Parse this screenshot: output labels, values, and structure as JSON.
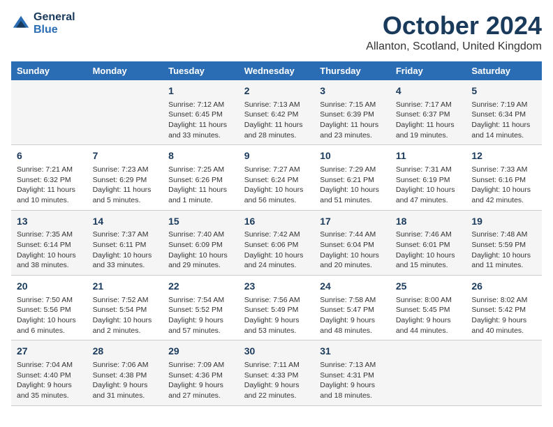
{
  "logo": {
    "line1": "General",
    "line2": "Blue"
  },
  "title": "October 2024",
  "subtitle": "Allanton, Scotland, United Kingdom",
  "days_of_week": [
    "Sunday",
    "Monday",
    "Tuesday",
    "Wednesday",
    "Thursday",
    "Friday",
    "Saturday"
  ],
  "weeks": [
    [
      {
        "num": "",
        "info": ""
      },
      {
        "num": "",
        "info": ""
      },
      {
        "num": "1",
        "info": "Sunrise: 7:12 AM\nSunset: 6:45 PM\nDaylight: 11 hours\nand 33 minutes."
      },
      {
        "num": "2",
        "info": "Sunrise: 7:13 AM\nSunset: 6:42 PM\nDaylight: 11 hours\nand 28 minutes."
      },
      {
        "num": "3",
        "info": "Sunrise: 7:15 AM\nSunset: 6:39 PM\nDaylight: 11 hours\nand 23 minutes."
      },
      {
        "num": "4",
        "info": "Sunrise: 7:17 AM\nSunset: 6:37 PM\nDaylight: 11 hours\nand 19 minutes."
      },
      {
        "num": "5",
        "info": "Sunrise: 7:19 AM\nSunset: 6:34 PM\nDaylight: 11 hours\nand 14 minutes."
      }
    ],
    [
      {
        "num": "6",
        "info": "Sunrise: 7:21 AM\nSunset: 6:32 PM\nDaylight: 11 hours\nand 10 minutes."
      },
      {
        "num": "7",
        "info": "Sunrise: 7:23 AM\nSunset: 6:29 PM\nDaylight: 11 hours\nand 5 minutes."
      },
      {
        "num": "8",
        "info": "Sunrise: 7:25 AM\nSunset: 6:26 PM\nDaylight: 11 hours\nand 1 minute."
      },
      {
        "num": "9",
        "info": "Sunrise: 7:27 AM\nSunset: 6:24 PM\nDaylight: 10 hours\nand 56 minutes."
      },
      {
        "num": "10",
        "info": "Sunrise: 7:29 AM\nSunset: 6:21 PM\nDaylight: 10 hours\nand 51 minutes."
      },
      {
        "num": "11",
        "info": "Sunrise: 7:31 AM\nSunset: 6:19 PM\nDaylight: 10 hours\nand 47 minutes."
      },
      {
        "num": "12",
        "info": "Sunrise: 7:33 AM\nSunset: 6:16 PM\nDaylight: 10 hours\nand 42 minutes."
      }
    ],
    [
      {
        "num": "13",
        "info": "Sunrise: 7:35 AM\nSunset: 6:14 PM\nDaylight: 10 hours\nand 38 minutes."
      },
      {
        "num": "14",
        "info": "Sunrise: 7:37 AM\nSunset: 6:11 PM\nDaylight: 10 hours\nand 33 minutes."
      },
      {
        "num": "15",
        "info": "Sunrise: 7:40 AM\nSunset: 6:09 PM\nDaylight: 10 hours\nand 29 minutes."
      },
      {
        "num": "16",
        "info": "Sunrise: 7:42 AM\nSunset: 6:06 PM\nDaylight: 10 hours\nand 24 minutes."
      },
      {
        "num": "17",
        "info": "Sunrise: 7:44 AM\nSunset: 6:04 PM\nDaylight: 10 hours\nand 20 minutes."
      },
      {
        "num": "18",
        "info": "Sunrise: 7:46 AM\nSunset: 6:01 PM\nDaylight: 10 hours\nand 15 minutes."
      },
      {
        "num": "19",
        "info": "Sunrise: 7:48 AM\nSunset: 5:59 PM\nDaylight: 10 hours\nand 11 minutes."
      }
    ],
    [
      {
        "num": "20",
        "info": "Sunrise: 7:50 AM\nSunset: 5:56 PM\nDaylight: 10 hours\nand 6 minutes."
      },
      {
        "num": "21",
        "info": "Sunrise: 7:52 AM\nSunset: 5:54 PM\nDaylight: 10 hours\nand 2 minutes."
      },
      {
        "num": "22",
        "info": "Sunrise: 7:54 AM\nSunset: 5:52 PM\nDaylight: 9 hours\nand 57 minutes."
      },
      {
        "num": "23",
        "info": "Sunrise: 7:56 AM\nSunset: 5:49 PM\nDaylight: 9 hours\nand 53 minutes."
      },
      {
        "num": "24",
        "info": "Sunrise: 7:58 AM\nSunset: 5:47 PM\nDaylight: 9 hours\nand 48 minutes."
      },
      {
        "num": "25",
        "info": "Sunrise: 8:00 AM\nSunset: 5:45 PM\nDaylight: 9 hours\nand 44 minutes."
      },
      {
        "num": "26",
        "info": "Sunrise: 8:02 AM\nSunset: 5:42 PM\nDaylight: 9 hours\nand 40 minutes."
      }
    ],
    [
      {
        "num": "27",
        "info": "Sunrise: 7:04 AM\nSunset: 4:40 PM\nDaylight: 9 hours\nand 35 minutes."
      },
      {
        "num": "28",
        "info": "Sunrise: 7:06 AM\nSunset: 4:38 PM\nDaylight: 9 hours\nand 31 minutes."
      },
      {
        "num": "29",
        "info": "Sunrise: 7:09 AM\nSunset: 4:36 PM\nDaylight: 9 hours\nand 27 minutes."
      },
      {
        "num": "30",
        "info": "Sunrise: 7:11 AM\nSunset: 4:33 PM\nDaylight: 9 hours\nand 22 minutes."
      },
      {
        "num": "31",
        "info": "Sunrise: 7:13 AM\nSunset: 4:31 PM\nDaylight: 9 hours\nand 18 minutes."
      },
      {
        "num": "",
        "info": ""
      },
      {
        "num": "",
        "info": ""
      }
    ]
  ]
}
